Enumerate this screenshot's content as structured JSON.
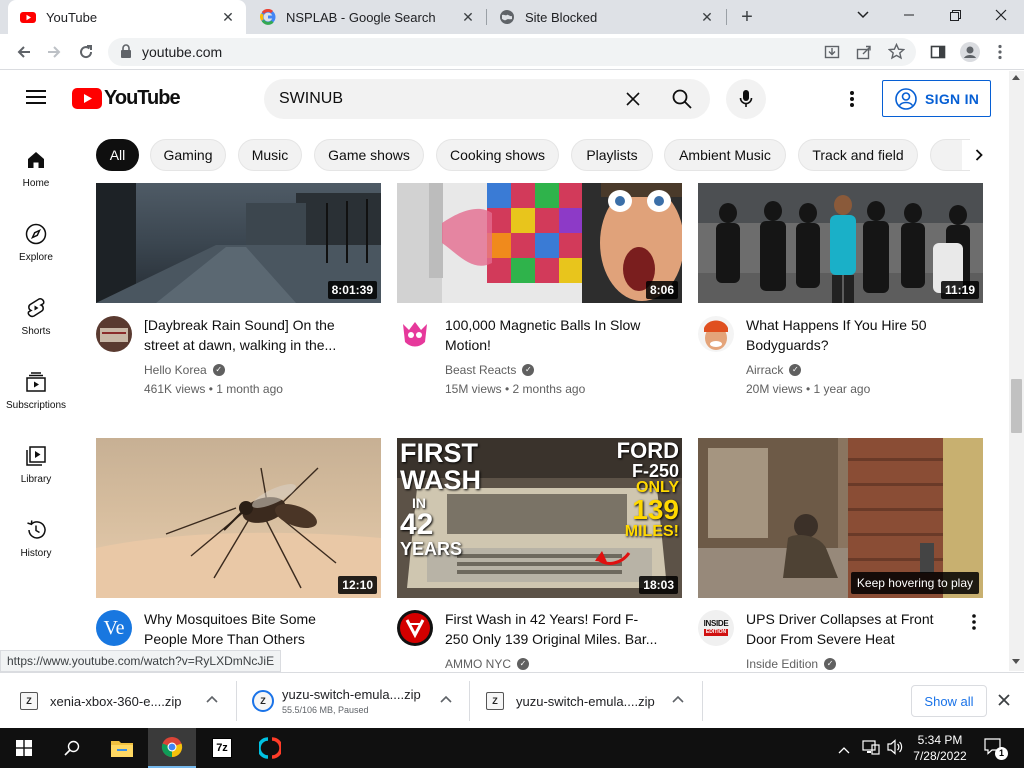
{
  "browser": {
    "tabs": [
      {
        "title": "YouTube",
        "active": true,
        "favicon": "youtube-icon"
      },
      {
        "title": "NSPLAB - Google Search",
        "active": false,
        "favicon": "google-icon"
      },
      {
        "title": "Site Blocked",
        "active": false,
        "favicon": "globe-icon"
      }
    ],
    "url": "youtube.com",
    "status_url": "https://www.youtube.com/watch?v=RyLXDmNcJiE"
  },
  "youtube": {
    "logo_text": "YouTube",
    "search_value": "SWINUB",
    "sign_in_label": "SIGN IN",
    "chips": [
      "All",
      "Gaming",
      "Music",
      "Game shows",
      "Cooking shows",
      "Playlists",
      "Ambient Music",
      "Track and field"
    ],
    "sidebar": [
      {
        "label": "Home",
        "icon": "home-icon"
      },
      {
        "label": "Explore",
        "icon": "compass-icon"
      },
      {
        "label": "Shorts",
        "icon": "shorts-icon"
      },
      {
        "label": "Subscriptions",
        "icon": "subscriptions-icon"
      },
      {
        "label": "Library",
        "icon": "library-icon"
      },
      {
        "label": "History",
        "icon": "history-icon"
      }
    ],
    "videos": [
      {
        "title_line1": "[Daybreak Rain Sound] On the",
        "title_line2": "street at dawn, walking in the...",
        "channel": "Hello Korea",
        "meta": "461K views • 1 month ago",
        "duration": "8:01:39"
      },
      {
        "title_line1": "100,000 Magnetic Balls In Slow",
        "title_line2": "Motion!",
        "channel": "Beast Reacts",
        "meta": "15M views • 2 months ago",
        "duration": "8:06"
      },
      {
        "title_line1": "What Happens If You Hire 50",
        "title_line2": "Bodyguards?",
        "channel": "Airrack",
        "meta": "20M views • 1 year ago",
        "duration": "11:19"
      },
      {
        "title_line1": "Why Mosquitoes Bite Some",
        "title_line2": "People More Than Others",
        "channel": "",
        "meta": "",
        "duration": "12:10"
      },
      {
        "title_line1": "First Wash in 42 Years! Ford F-",
        "title_line2": "250 Only 139 Original Miles. Bar...",
        "channel": "AMMO NYC",
        "meta": "",
        "duration": "18:03"
      },
      {
        "title_line1": "UPS Driver Collapses at Front",
        "title_line2": "Door From Severe Heat",
        "channel": "Inside Edition",
        "meta": "",
        "duration": "Keep hovering to play"
      }
    ],
    "thumb_text": {
      "wash_first": "FIRST",
      "wash_wash": "WASH",
      "wash_in": "IN",
      "wash_42": "42",
      "wash_years": "YEARS",
      "ford": "FORD",
      "f250": "F-250",
      "only": "ONLY",
      "miles_139": "139",
      "miles": "MILES!"
    },
    "avatar_text": {
      "ve": "Ve",
      "inside": "INSIDE",
      "edition": "EDITION"
    }
  },
  "downloads": [
    {
      "name": "xenia-xbox-360-e....zip",
      "sub": ""
    },
    {
      "name": "yuzu-switch-emula....zip",
      "sub": "55.5/106 MB, Paused"
    },
    {
      "name": "yuzu-switch-emula....zip",
      "sub": ""
    }
  ],
  "downloads_show_all": "Show all",
  "taskbar": {
    "time": "5:34 PM",
    "date": "7/28/2022",
    "notification_count": "1",
    "seven_zip_label": "7z"
  },
  "colors": {
    "youtube_red": "#ff0000",
    "link_blue": "#065fd4",
    "chip_active": "#0f0f0f"
  }
}
